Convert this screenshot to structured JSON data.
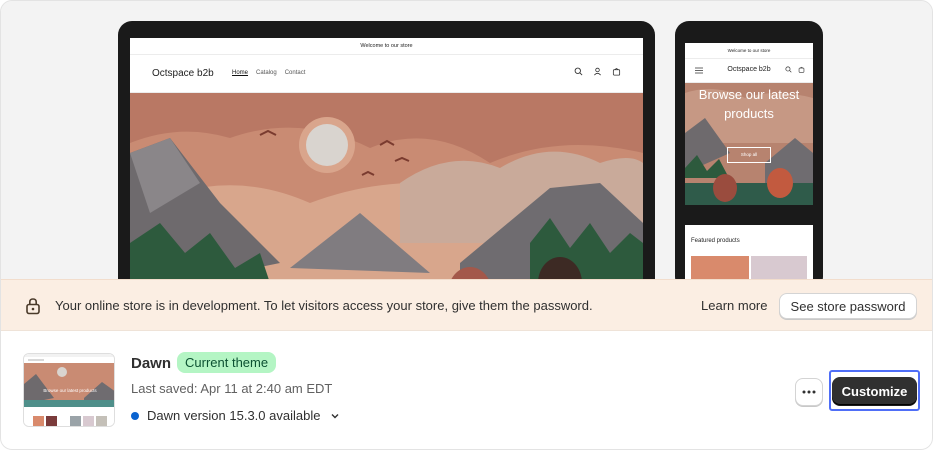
{
  "preview": {
    "laptop": {
      "announcement": "Welcome to our store",
      "brand": "Octspace b2b",
      "nav": [
        "Home",
        "Catalog",
        "Contact"
      ]
    },
    "phone": {
      "announcement": "Welcome to our store",
      "brand": "Octspace b2b",
      "hero_line1": "Browse our latest",
      "hero_line2": "products",
      "shop_all": "Shop all",
      "featured": "Featured products"
    },
    "header_icons": [
      "search-icon",
      "account-icon",
      "cart-icon"
    ]
  },
  "banner": {
    "icon": "lock-icon",
    "message": "Your online store is in development. To let visitors access your store, give them the password.",
    "learn_more": "Learn more",
    "password_button": "See store password",
    "background": "#fbeee3"
  },
  "theme": {
    "name": "Dawn",
    "badge": "Current theme",
    "badge_color": "#b4f5c4",
    "last_saved": "Last saved: Apr 11 at 2:40 am EDT",
    "version": "Dawn version 15.3.0 available",
    "version_dot_color": "#0a63d0",
    "thumb_text": "Browse our latest products",
    "more_icon": "ellipsis-icon",
    "customize_button": "Customize"
  }
}
